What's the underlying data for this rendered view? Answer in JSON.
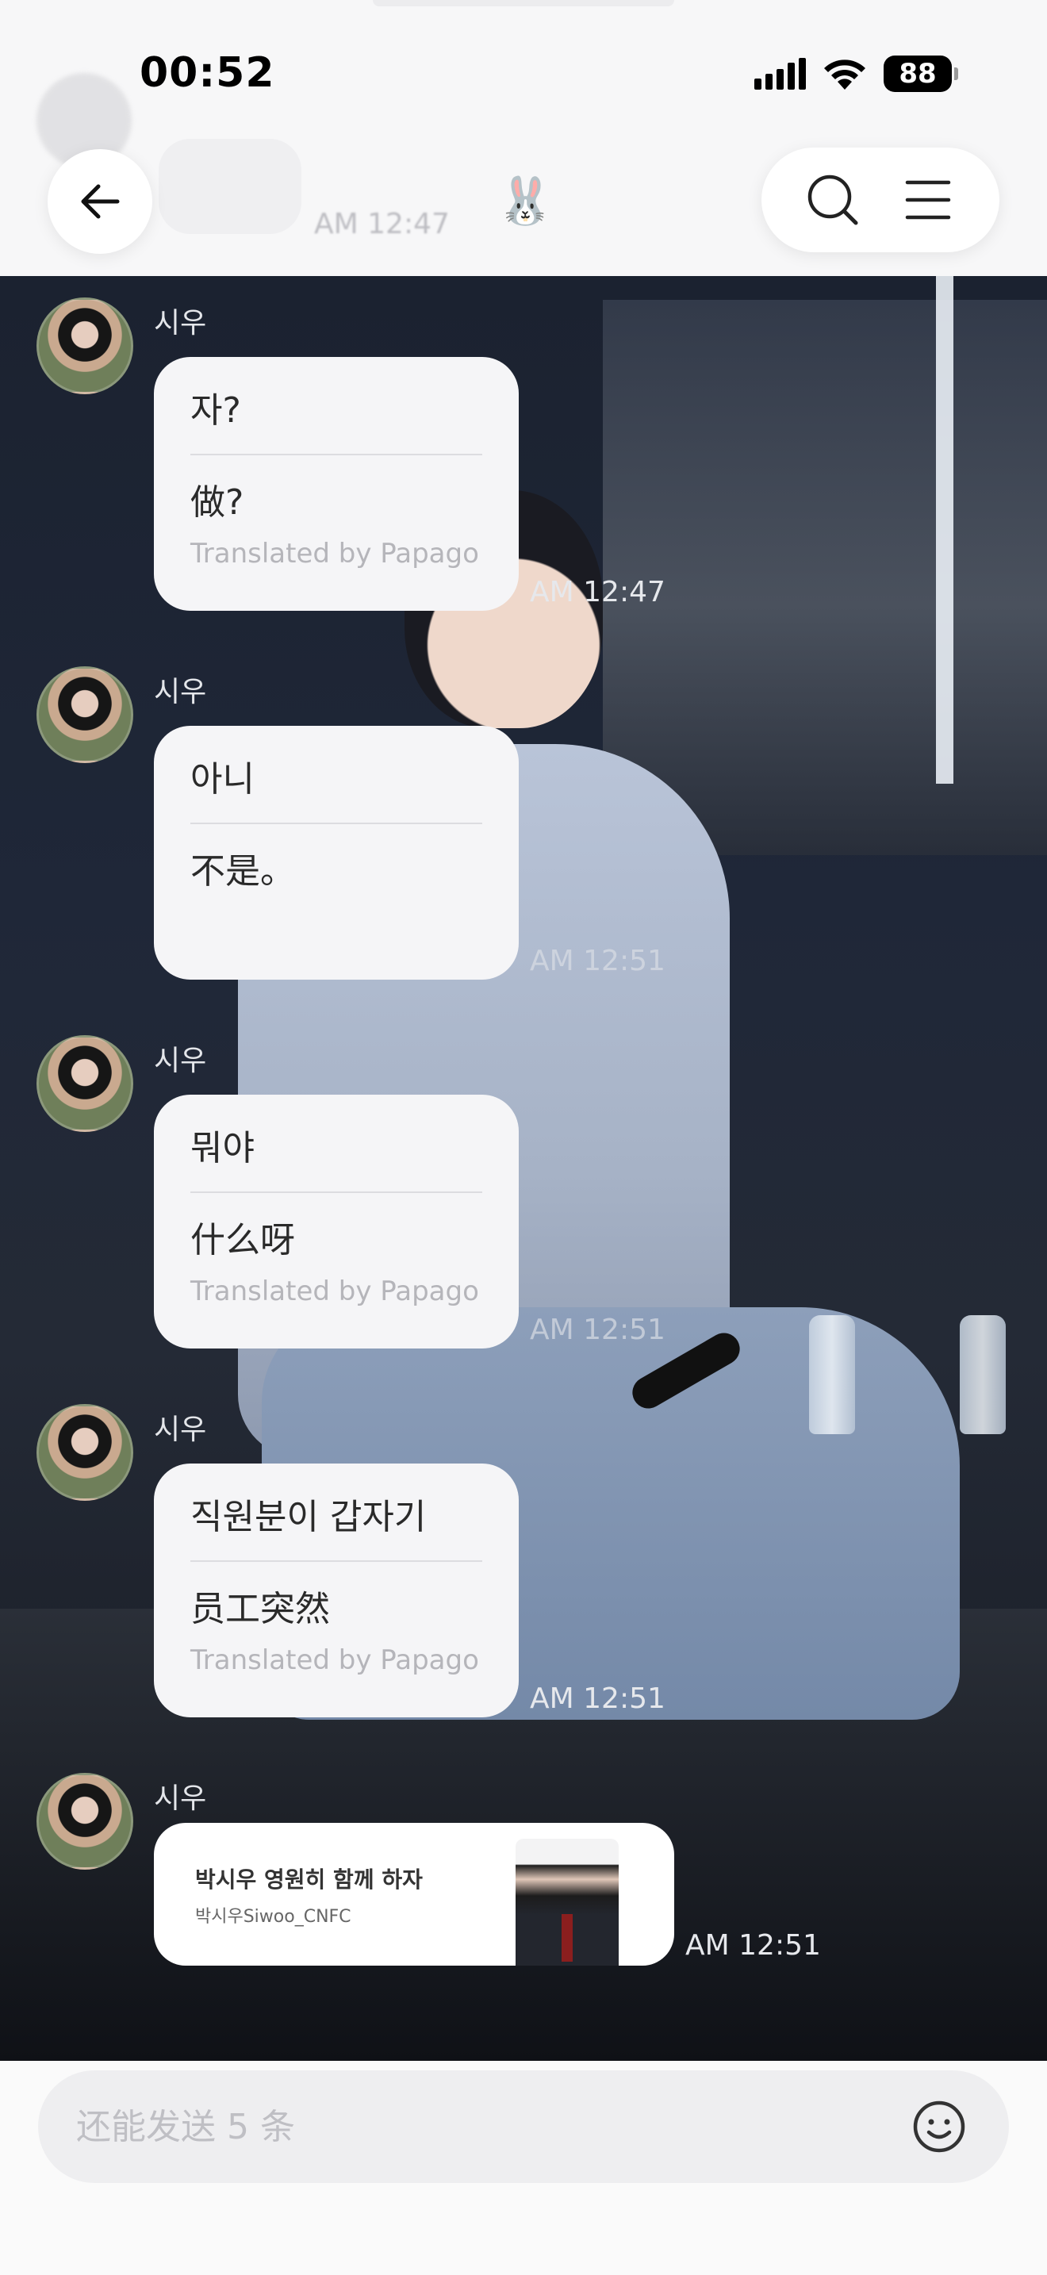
{
  "status_bar": {
    "time": "00:52",
    "battery": "88"
  },
  "header": {
    "title_emoji": "🐰"
  },
  "ghost": {
    "timestamp": "AM 12:47"
  },
  "messages": [
    {
      "sender": "시우",
      "original": "자?",
      "translated": "做?",
      "credit": "Translated by Papago",
      "time": "AM 12:47"
    },
    {
      "sender": "시우",
      "original": "아니",
      "translated": "不是。",
      "credit": "",
      "time": "AM 12:51"
    },
    {
      "sender": "시우",
      "original": "뭐야",
      "translated": "什么呀",
      "credit": "Translated by Papago",
      "time": "AM 12:51"
    },
    {
      "sender": "시우",
      "original": "직원분이 갑자기",
      "translated": "员工突然",
      "credit": "Translated by Papago",
      "time": "AM 12:51"
    }
  ],
  "link_message": {
    "sender": "시우",
    "title": "박시우 영원히 함께 하자",
    "subtitle": "박시우Siwoo_CNFC",
    "time": "AM 12:51"
  },
  "input": {
    "placeholder": "还能发送 5 条"
  }
}
